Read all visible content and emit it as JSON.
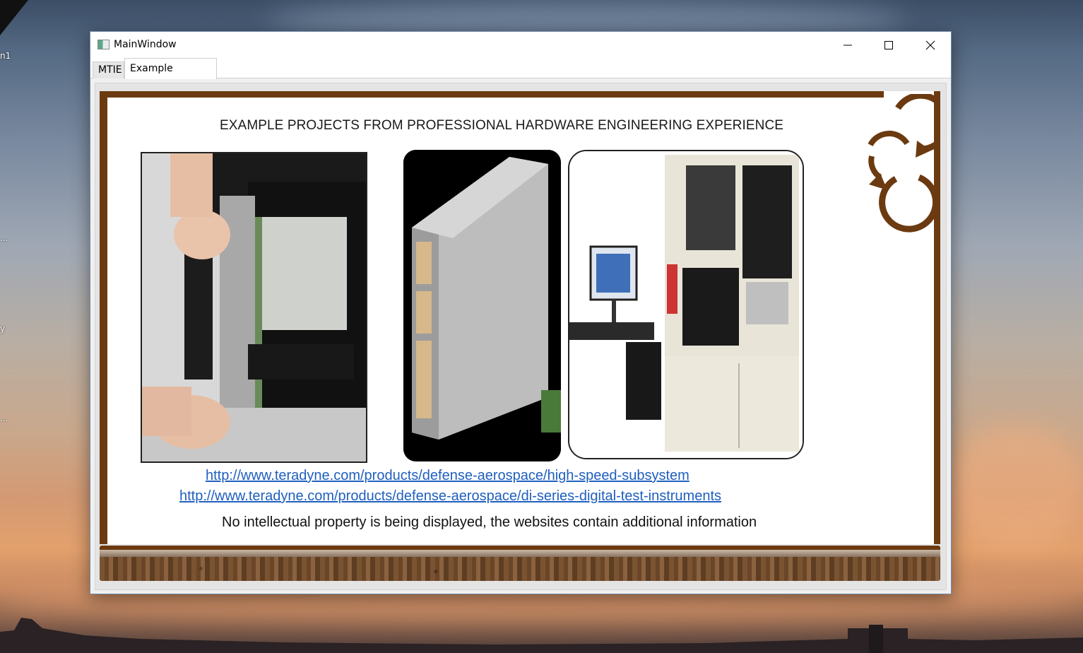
{
  "desktop": {
    "labels": [
      "n1",
      "...",
      "y",
      "..."
    ]
  },
  "window": {
    "title": "MainWindow",
    "controls": {
      "minimize": "minimize-icon",
      "maximize": "maximize-icon",
      "close": "close-icon"
    }
  },
  "tabs": [
    {
      "label": "MTIE",
      "selected": false
    },
    {
      "label": "Example Projects",
      "selected": true
    }
  ],
  "content": {
    "heading": "EXAMPLE PROJECTS FROM PROFESSIONAL HARDWARE ENGINEERING EXPERIENCE",
    "images": [
      "hands inserting instrument module into test chassis",
      "high-speed subsystem instrument card",
      "test system cabinet with monitor and keyboard"
    ],
    "links": [
      "http://www.teradyne.com/products/defense-aerospace/high-speed-subsystem",
      "http://www.teradyne.com/products/defense-aerospace/di-series-digital-test-instruments"
    ],
    "note": "No intellectual property is being displayed, the websites contain additional information"
  },
  "colors": {
    "frame": "#6b3a10",
    "link": "#1f5fbf",
    "panel": "#e4e4e4"
  }
}
